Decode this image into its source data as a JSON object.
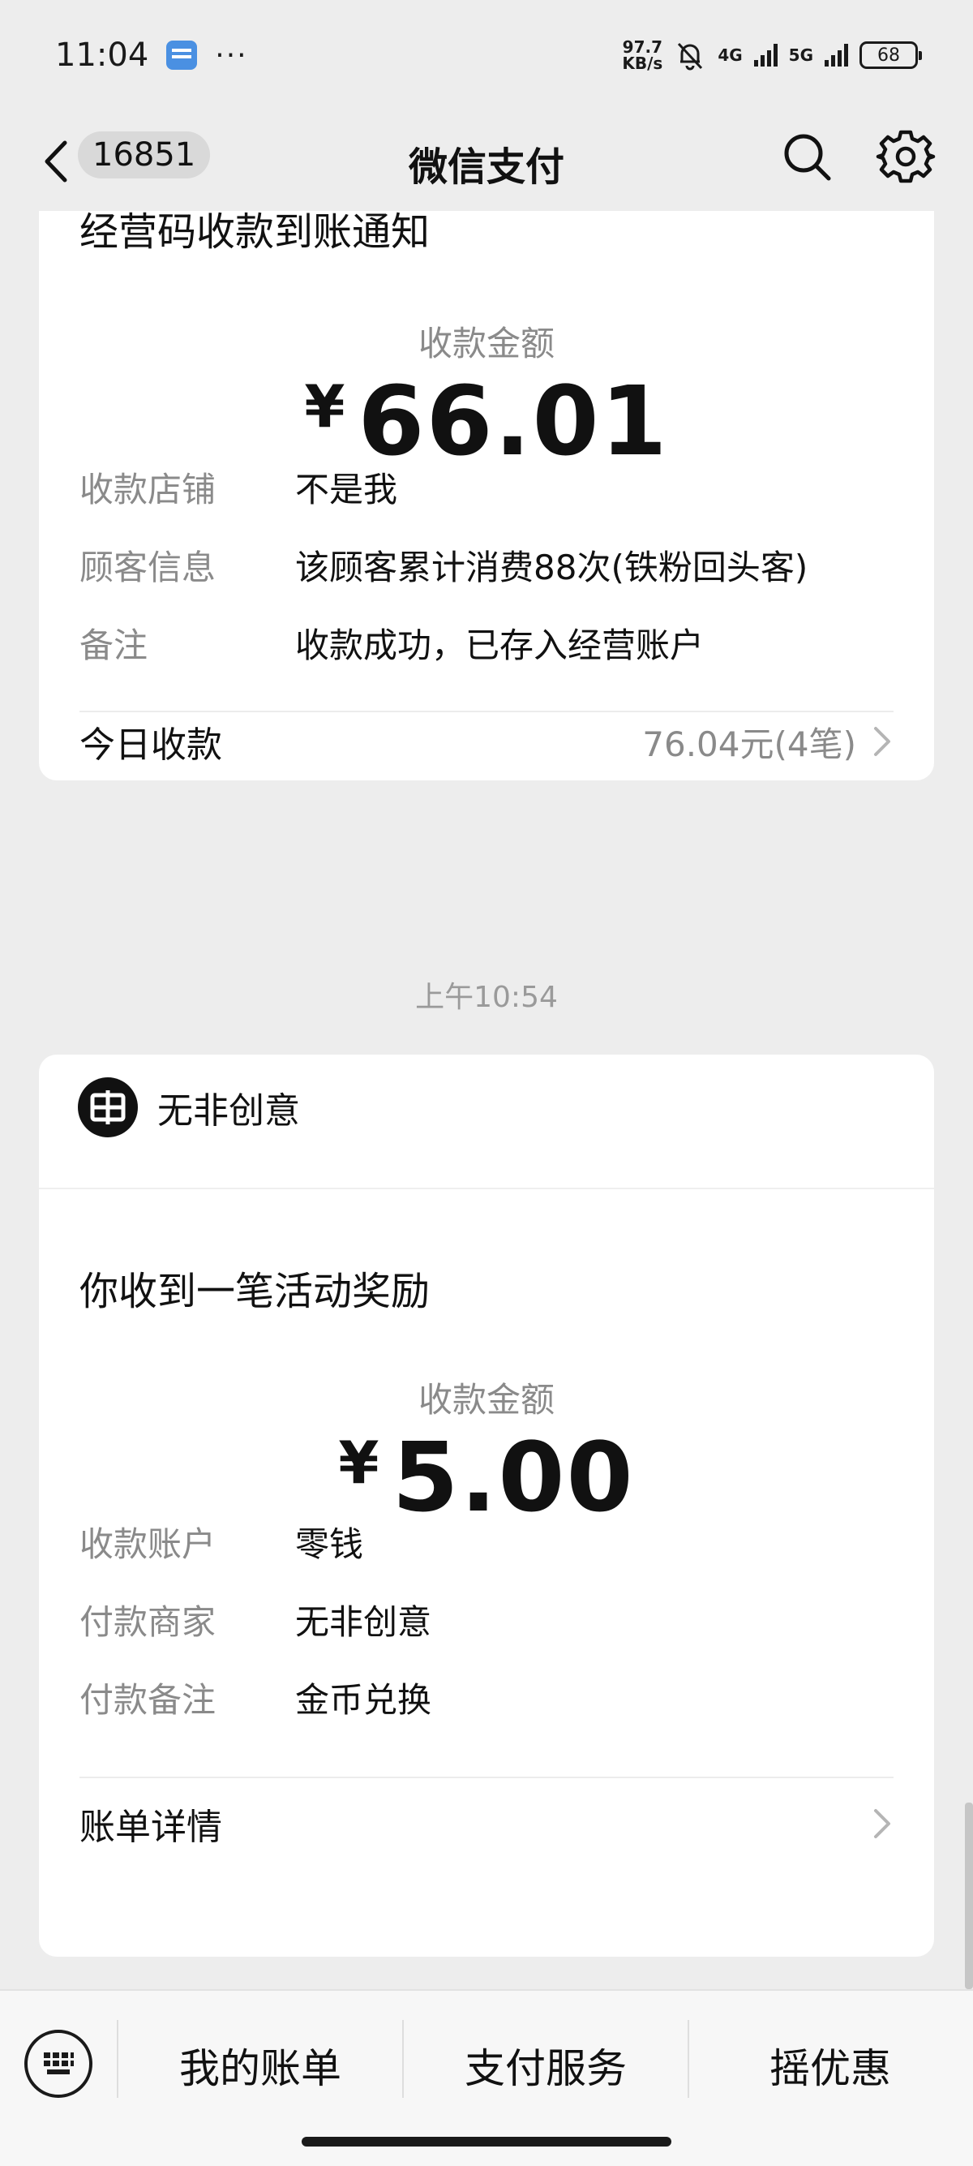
{
  "status_bar": {
    "time": "11:04",
    "dots": "···",
    "net_speed_value": "97.7",
    "net_speed_unit": "KB/s",
    "net1": "4G",
    "net2": "5G",
    "battery": "68"
  },
  "nav": {
    "unread_count": "16851",
    "title": "微信支付"
  },
  "message1": {
    "title": "经营码收款到账通知",
    "amount_label": "收款金额",
    "currency": "¥",
    "amount": "66.01",
    "rows": [
      {
        "key": "收款店铺",
        "value": "不是我"
      },
      {
        "key": "顾客信息",
        "value": "该顾客累计消费88次(铁粉回头客)"
      },
      {
        "key": "备注",
        "value": "收款成功，已存入经营账户"
      }
    ],
    "footer_label": "今日收款",
    "footer_value": "76.04元(4笔)"
  },
  "time_label": "上午10:54",
  "message2": {
    "merchant_name": "无非创意",
    "title": "你收到一笔活动奖励",
    "amount_label": "收款金额",
    "currency": "¥",
    "amount": "5.00",
    "rows": [
      {
        "key": "收款账户",
        "value": "零钱"
      },
      {
        "key": "付款商家",
        "value": "无非创意"
      },
      {
        "key": "付款备注",
        "value": "金币兑换"
      }
    ],
    "footer_label": "账单详情"
  },
  "bottom_bar": {
    "items": [
      "我的账单",
      "支付服务",
      "摇优惠"
    ]
  }
}
